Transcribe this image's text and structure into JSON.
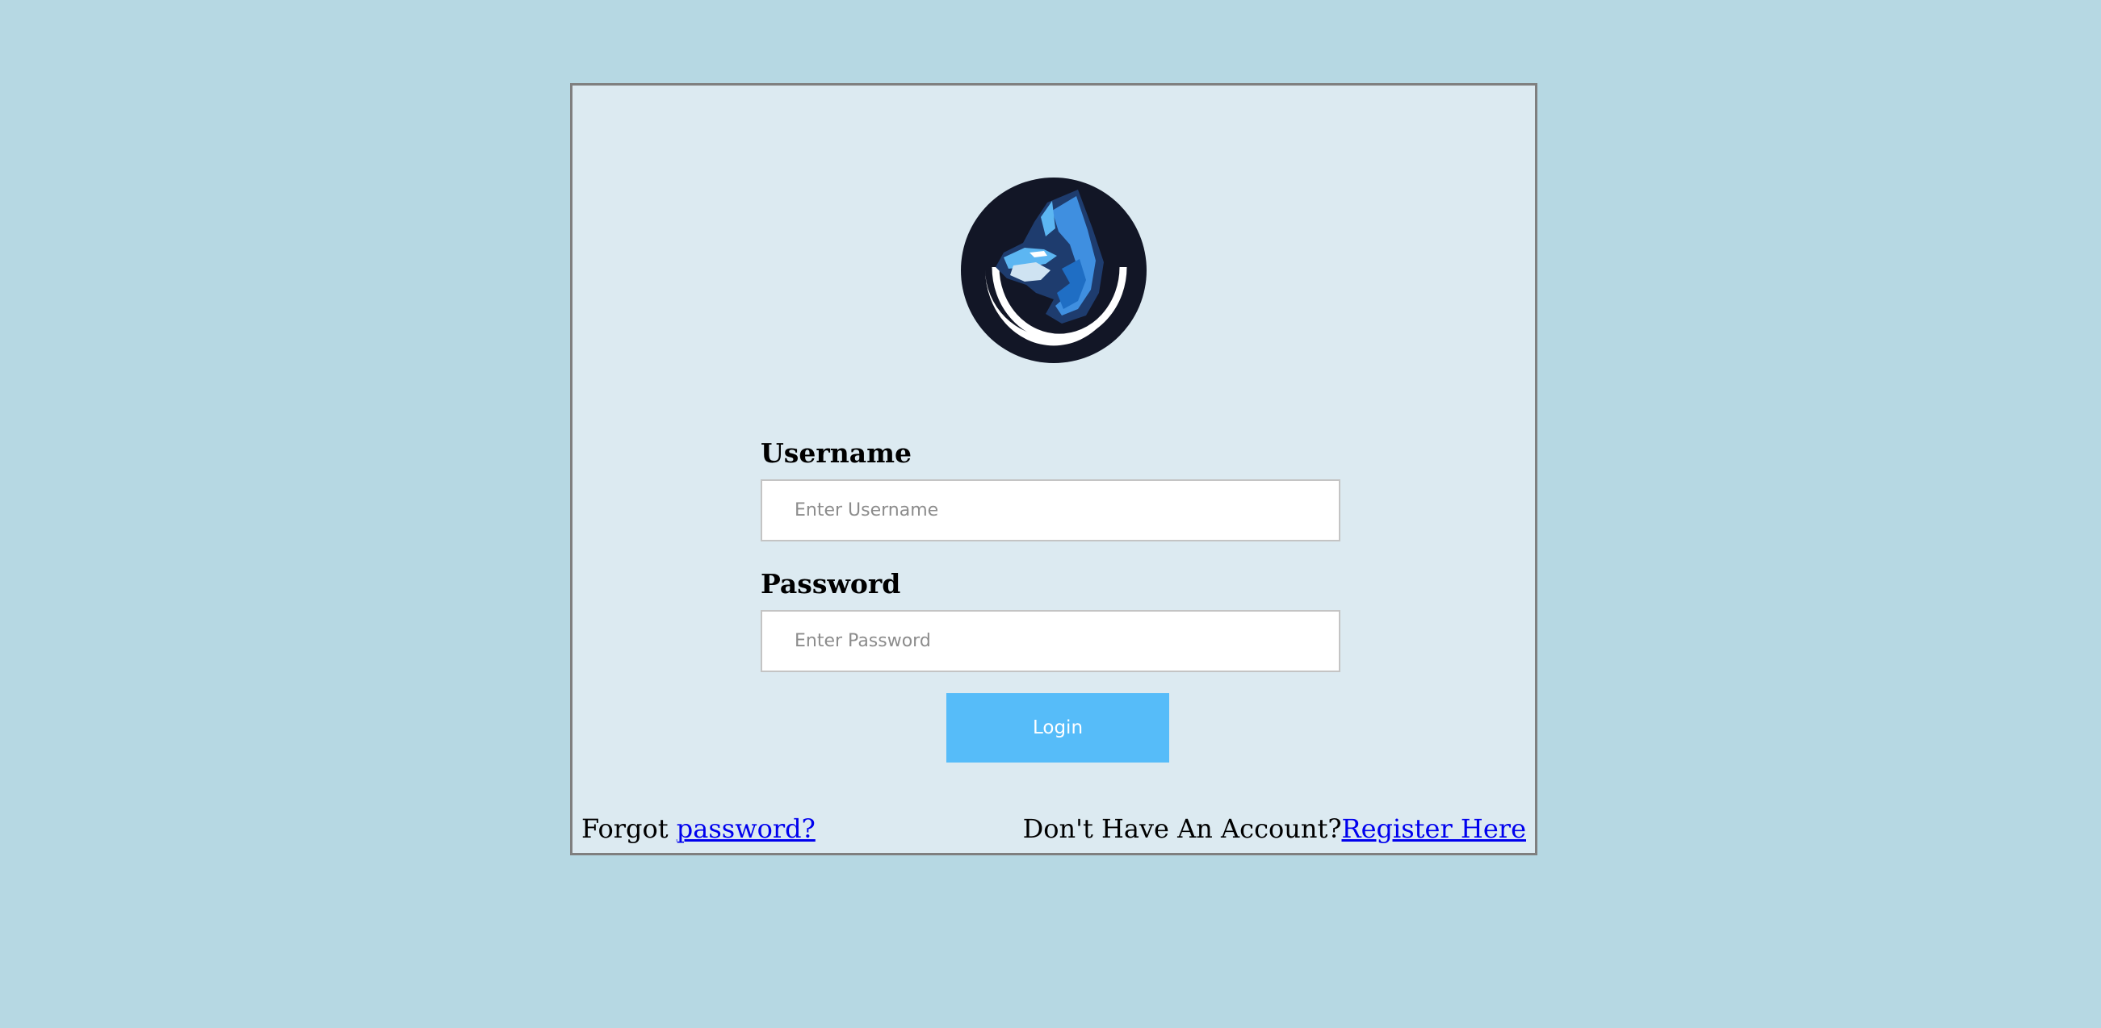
{
  "login": {
    "username_label": "Username",
    "username_placeholder": "Enter Username",
    "username_value": "",
    "password_label": "Password",
    "password_placeholder": "Enter Password",
    "password_value": "",
    "login_button": "Login"
  },
  "footer": {
    "forgot_prefix": "Forgot ",
    "forgot_link": "password?",
    "register_prefix": "Don't Have An Account?",
    "register_link": "Register Here"
  },
  "colors": {
    "page_background": "#b6d8e3",
    "card_background": "#dceaf1",
    "card_border": "#7f7f7f",
    "button_background": "#56bcf9",
    "link": "#0000ee",
    "logo_dark": "#121626",
    "logo_blue": "#3f8fe0",
    "logo_light_blue": "#5cb6f2"
  },
  "icons": {
    "logo": "wolf-logo-icon"
  }
}
